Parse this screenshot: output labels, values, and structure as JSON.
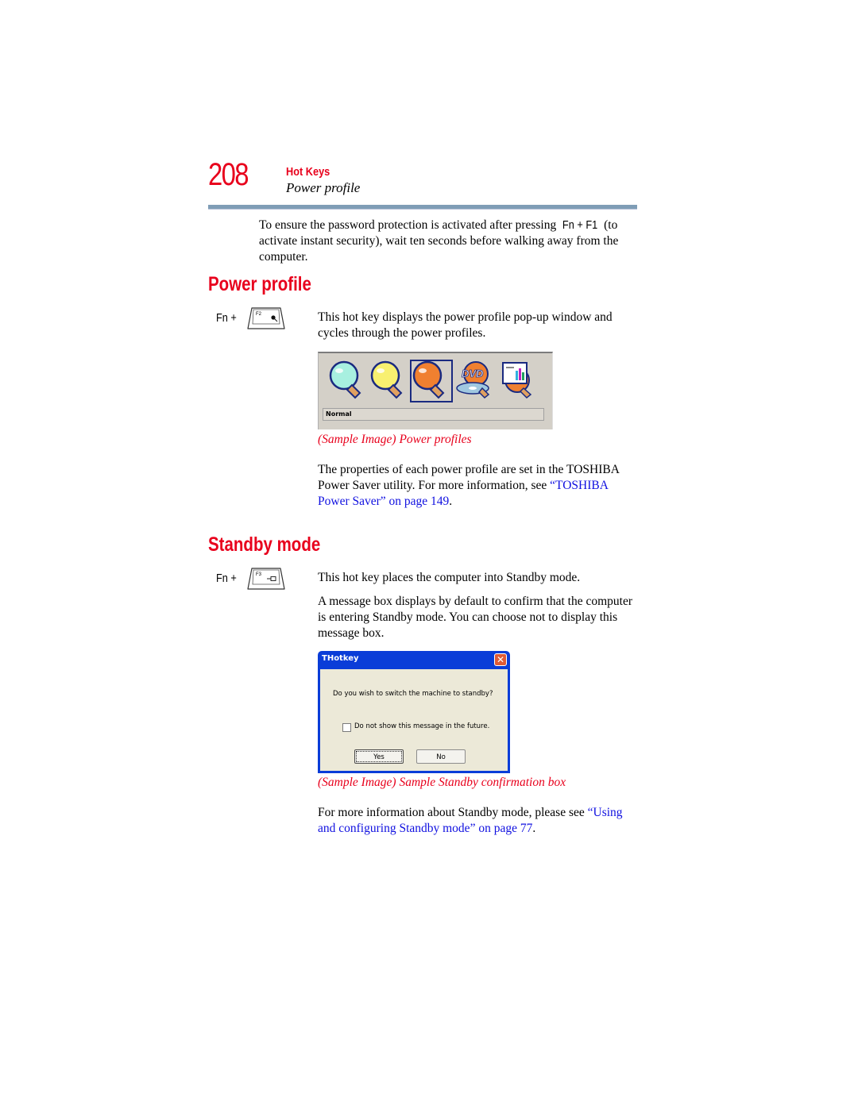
{
  "header": {
    "page_number": "208",
    "chapter": "Hot Keys",
    "section": "Power profile"
  },
  "intro": {
    "text_before": "To ensure the password protection is activated after pressing ",
    "key_combo": "Fn + F1",
    "text_after": " (to activate instant security), wait ten seconds before walking away from the computer."
  },
  "power_profile": {
    "heading": "Power profile",
    "fn_label": "Fn +",
    "key_label": "F2",
    "description": "This hot key displays the power profile pop-up window and cycles through the power profiles.",
    "window": {
      "icons": [
        "power-saver-cyan-bulb-icon",
        "power-saver-yellow-bulb-icon",
        "power-saver-orange-bulb-icon",
        "dvd-playback-icon",
        "presentation-icon"
      ],
      "selected_index": 2,
      "status": "Normal"
    },
    "caption": "(Sample Image) Power profiles",
    "properties_text": "The properties of each power profile are set in the TOSHIBA Power Saver utility. For more information, see ",
    "link": "“TOSHIBA Power Saver” on page 149",
    "link_suffix": "."
  },
  "standby": {
    "heading": "Standby mode",
    "fn_label": "Fn +",
    "key_label": "F3",
    "description": "This hot key places the computer into Standby mode.",
    "message_text": "A message box displays by default to confirm that the computer is entering Standby mode. You can choose not to display this message box.",
    "dialog": {
      "title": "THotkey",
      "close": "✕",
      "message": "Do you wish to switch the machine to standby?",
      "checkbox_label": "Do not show this message in the future.",
      "checkbox_checked": false,
      "yes_label": "Yes",
      "no_label": "No"
    },
    "caption": "(Sample Image) Sample Standby confirmation box",
    "more_info_text": "For more information about Standby mode, please see ",
    "link": "“Using and configuring Standby mode” on page 77",
    "link_suffix": "."
  },
  "colors": {
    "accent_red": "#e8001c",
    "link_blue": "#1010e0",
    "rule": "#7f9db6"
  }
}
